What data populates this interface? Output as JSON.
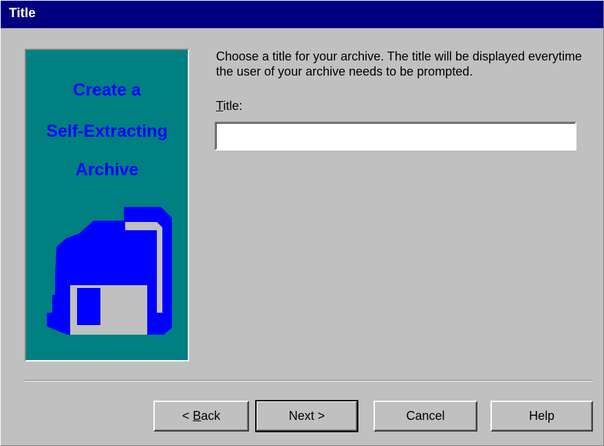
{
  "window": {
    "title": "Title"
  },
  "banner": {
    "lines": [
      "Create a",
      "Self-Extracting",
      "Archive"
    ],
    "icon": "floppy-disk-icon",
    "colors": {
      "background": "#008080",
      "text": "#0000ff"
    }
  },
  "instructions": "Choose a title for your archive.  The title will be displayed everytime the user of your archive needs to be prompted.",
  "title_field": {
    "label_mnemonic": "T",
    "label_rest": "itle:",
    "value": ""
  },
  "buttons": {
    "back_prefix": "< ",
    "back_mnemonic": "B",
    "back_rest": "ack",
    "next": "Next >",
    "cancel": "Cancel",
    "help": "Help"
  }
}
